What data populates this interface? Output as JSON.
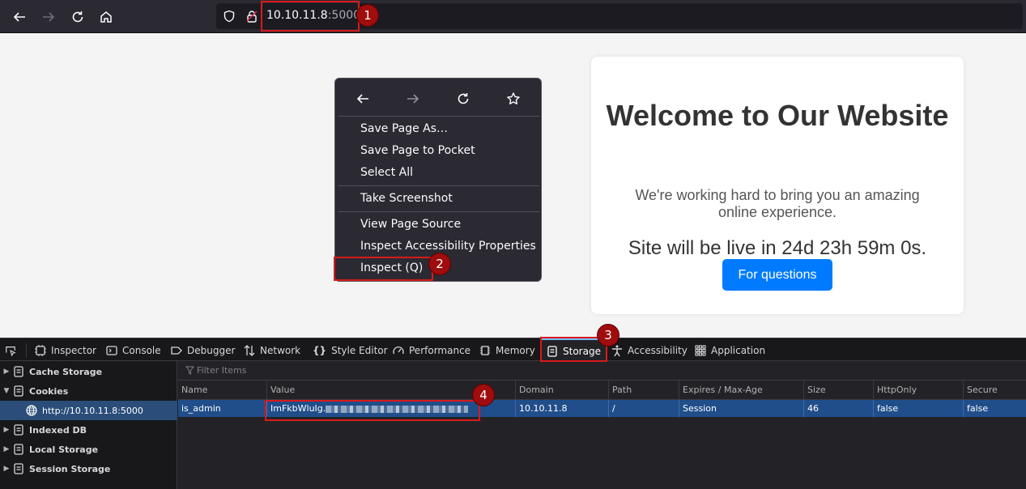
{
  "browser": {
    "url_host": "10.10.11.8",
    "url_port": ":5000",
    "icons": [
      "back-arrow-icon",
      "forward-arrow-icon",
      "reload-icon",
      "home-icon",
      "shield-icon",
      "lock-icon"
    ]
  },
  "annotations": [
    "1",
    "2",
    "3",
    "4"
  ],
  "page": {
    "title": "Welcome to Our Website",
    "text": "We're working hard to bring you an amazing online experience.",
    "countdown": "Site will be live in 24d 23h 59m 0s.",
    "button": "For questions",
    "button_color": "#007bff"
  },
  "context_menu": {
    "items": [
      "Save Page As…",
      "Save Page to Pocket",
      "Select All",
      "Take Screenshot",
      "View Page Source",
      "Inspect Accessibility Properties",
      "Inspect (Q)"
    ]
  },
  "devtools": {
    "tabs": [
      "Inspector",
      "Console",
      "Debugger",
      "Network",
      "Style Editor",
      "Performance",
      "Memory",
      "Storage",
      "Accessibility",
      "Application"
    ],
    "active_tab": "Storage",
    "sidebar": [
      "Cache Storage",
      "Cookies",
      "http://10.10.11.8:5000",
      "Indexed DB",
      "Local Storage",
      "Session Storage"
    ],
    "filter_placeholder": "Filter Items",
    "columns": [
      "Name",
      "Value",
      "Domain",
      "Path",
      "Expires / Max-Age",
      "Size",
      "HttpOnly",
      "Secure"
    ],
    "row": {
      "name": "is_admin",
      "value": "ImFkbWluIg.",
      "domain": "10.10.11.8",
      "path": "/",
      "expires": "Session",
      "size": "46",
      "httponly": "false",
      "secure": "false"
    }
  }
}
